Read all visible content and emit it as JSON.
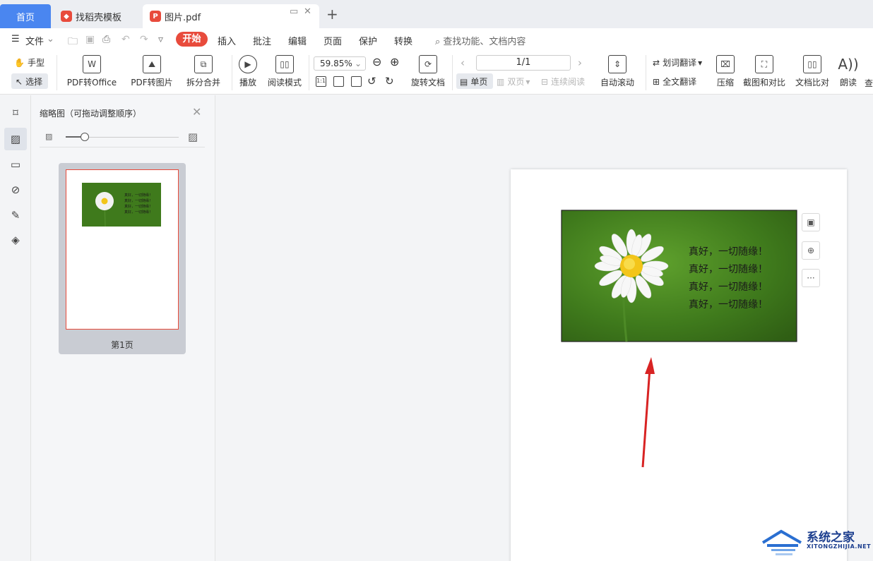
{
  "tabs": {
    "home": "首页",
    "template": "找稻壳模板",
    "pdf": "图片.pdf",
    "new_tab": "+"
  },
  "menu": {
    "file": "文件",
    "items": [
      "开始",
      "插入",
      "批注",
      "编辑",
      "页面",
      "保护",
      "转换"
    ],
    "search": "查找功能、文档内容"
  },
  "toolbar": {
    "hand": "手型",
    "select": "选择",
    "pdf_to_office": "PDF转Office",
    "pdf_to_image": "PDF转图片",
    "split_merge": "拆分合并",
    "play": "播放",
    "read_mode": "阅读模式",
    "zoom": "59.85%",
    "rotate_doc": "旋转文档",
    "page": "1/1",
    "single": "单页",
    "double": "双页",
    "continuous": "连续阅读",
    "auto_scroll": "自动滚动",
    "word_translate": "划词翻译",
    "full_translate": "全文翻译",
    "compress": "压缩",
    "screenshot_compare": "截图和对比",
    "doc_compare": "文档比对",
    "read_aloud": "朗读",
    "cut_off": "查"
  },
  "panel": {
    "title": "缩略图（可拖动调整顺序）",
    "page_label": "第1页"
  },
  "document": {
    "lines": [
      "真好，一切随缘！",
      "真好，一切随缘！",
      "真好，一切随缘！",
      "真好，一切随缘！"
    ]
  },
  "watermark": {
    "title": "系统之家",
    "sub": "XITONGZHIJIA.NET"
  },
  "colors": {
    "accent_blue": "#4a86f0",
    "brand_red": "#e84b3c",
    "arrow_red": "#d82323",
    "photo_green": "#3f7a1c"
  }
}
